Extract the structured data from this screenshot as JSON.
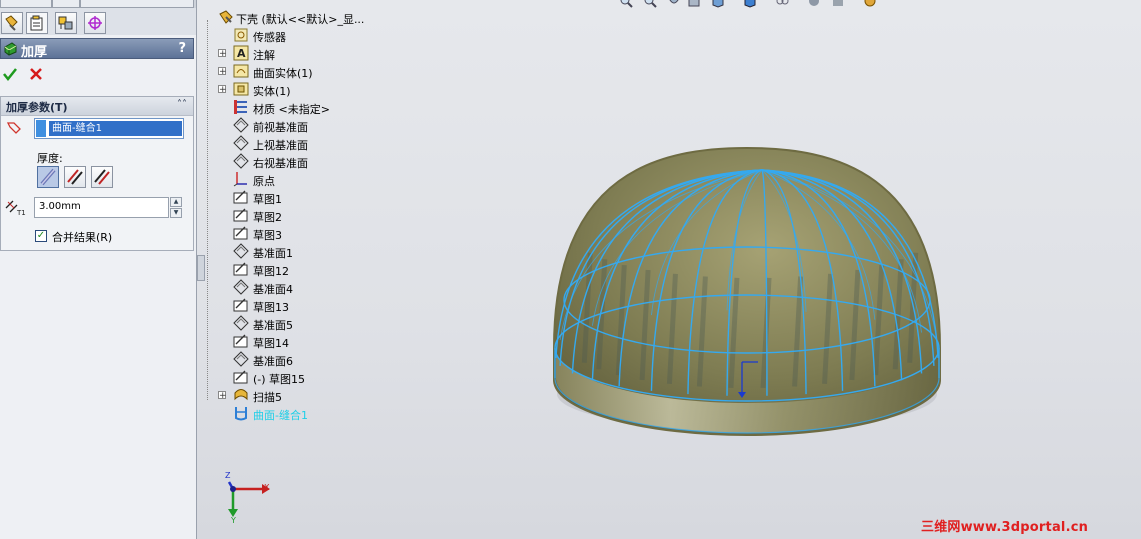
{
  "property_manager": {
    "title": "加厚",
    "help": "?",
    "section_title": "加厚参数(T)",
    "selected_face": "曲面-缝合1",
    "thickness_label": "厚度:",
    "thickness_value": "3.00mm",
    "merge_label": "合并结果(R)",
    "merge_checked": true
  },
  "tree": {
    "items": [
      {
        "label": "下壳  (默认<<默认>_显...",
        "icon": "part-icon",
        "expander": "none"
      },
      {
        "label": "传感器",
        "icon": "sensor-icon",
        "expander": "none"
      },
      {
        "label": "注解",
        "icon": "annotation-icon",
        "expander": "+"
      },
      {
        "label": "曲面实体(1)",
        "icon": "surface-bodies-icon",
        "expander": "+"
      },
      {
        "label": "实体(1)",
        "icon": "solid-bodies-icon",
        "expander": "+"
      },
      {
        "label": "材质 <未指定>",
        "icon": "material-icon",
        "expander": "none"
      },
      {
        "label": "前视基准面",
        "icon": "plane-icon",
        "expander": "none"
      },
      {
        "label": "上视基准面",
        "icon": "plane-icon",
        "expander": "none"
      },
      {
        "label": "右视基准面",
        "icon": "plane-icon",
        "expander": "none"
      },
      {
        "label": "原点",
        "icon": "origin-icon",
        "expander": "none"
      },
      {
        "label": "草图1",
        "icon": "sketch-icon",
        "expander": "none"
      },
      {
        "label": "草图2",
        "icon": "sketch-icon",
        "expander": "none"
      },
      {
        "label": "草图3",
        "icon": "sketch-icon",
        "expander": "none"
      },
      {
        "label": "基准面1",
        "icon": "plane-icon",
        "expander": "none"
      },
      {
        "label": "草图12",
        "icon": "sketch-icon",
        "expander": "none"
      },
      {
        "label": "基准面4",
        "icon": "plane-icon",
        "expander": "none"
      },
      {
        "label": "草图13",
        "icon": "sketch-icon",
        "expander": "none"
      },
      {
        "label": "基准面5",
        "icon": "plane-icon",
        "expander": "none"
      },
      {
        "label": "草图14",
        "icon": "sketch-icon",
        "expander": "none"
      },
      {
        "label": "基准面6",
        "icon": "plane-icon",
        "expander": "none"
      },
      {
        "label": "(-) 草图15",
        "icon": "sketch-icon",
        "expander": "none"
      },
      {
        "label": "扫描5",
        "icon": "sweep-icon",
        "expander": "+"
      },
      {
        "label": "曲面-缝合1",
        "icon": "knit-surface-icon",
        "expander": "none",
        "highlight": true
      }
    ]
  },
  "triad": {
    "x": "X",
    "y": "Y",
    "z": "Z"
  },
  "watermark": "三维网www.3dportal.cn",
  "colors": {
    "highlight_text": "#1ecfe8",
    "header_bg": "#6a7fa3",
    "dome_fill": "#7e7c52",
    "wire": "#35a9ef",
    "watermark": "#e02020"
  }
}
